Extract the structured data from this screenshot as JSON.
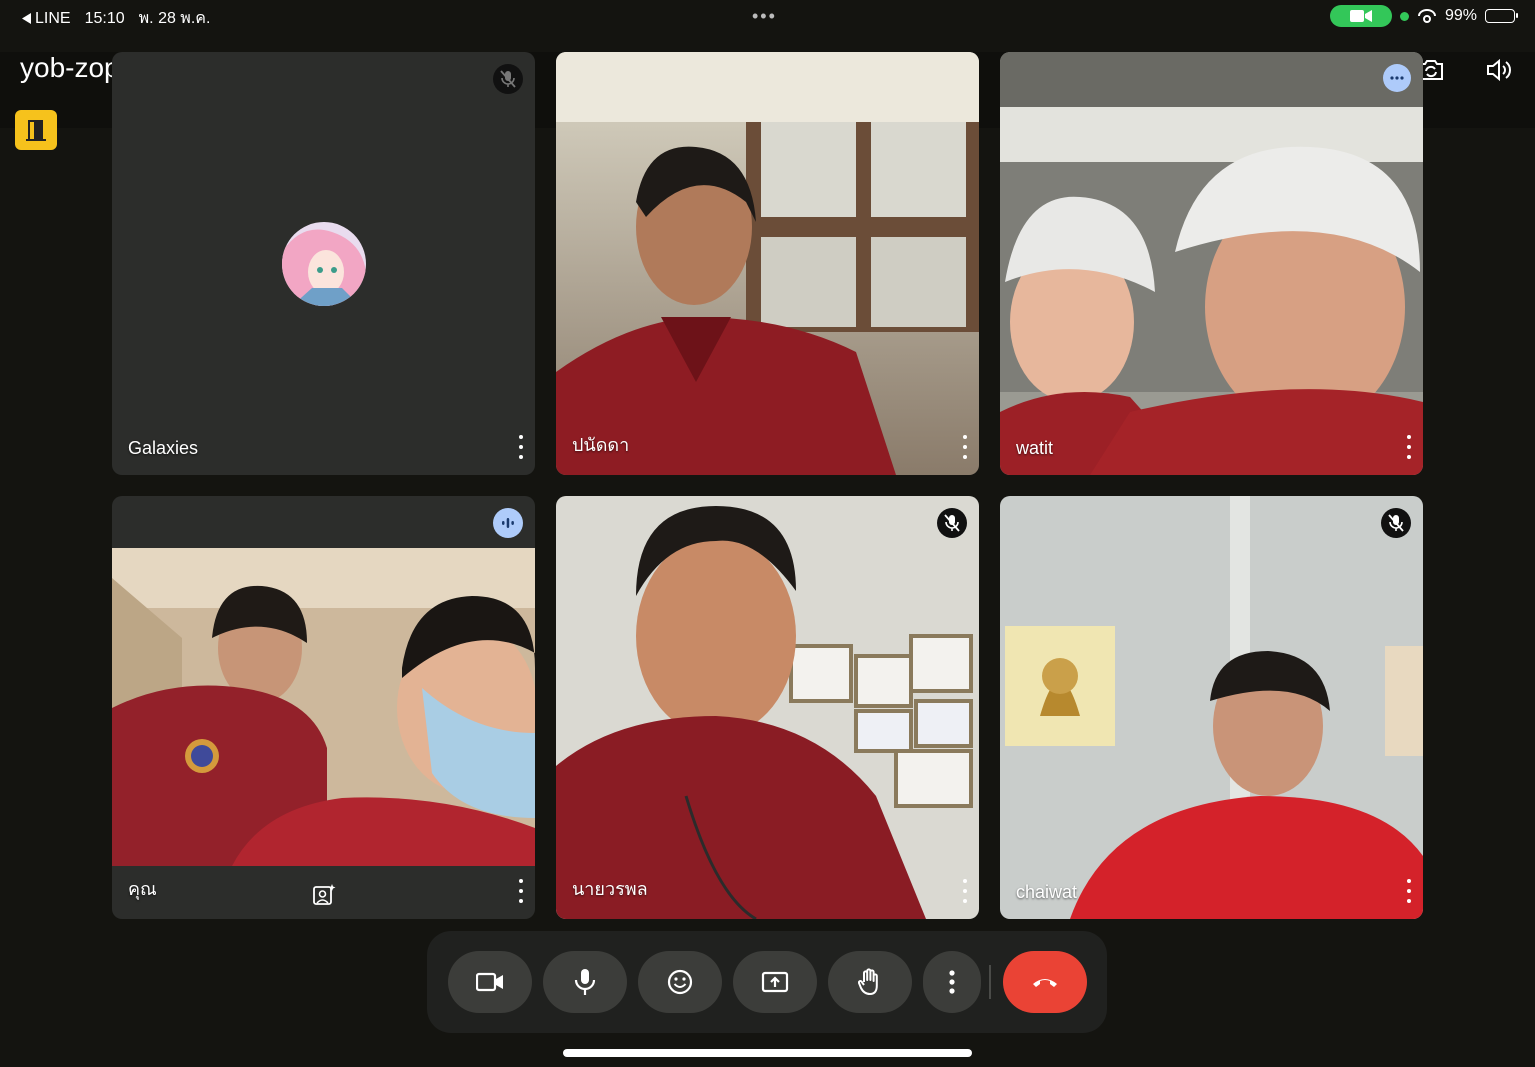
{
  "status_bar": {
    "back_app": "LINE",
    "time": "15:10",
    "date": "พ. 28 พ.ค.",
    "battery": "99%",
    "camera_active_color": "#33c759"
  },
  "meeting": {
    "code": "yob-zopp-gna"
  },
  "participants": [
    {
      "name": "Galaxies",
      "mic": "muted",
      "video": "off"
    },
    {
      "name": "ปนัดดา",
      "mic": "on",
      "video": "on"
    },
    {
      "name": "watit",
      "mic": "on",
      "video": "on",
      "indicator": "more-options"
    },
    {
      "name": "คุณ",
      "mic": "speaking",
      "video": "on",
      "is_self": true
    },
    {
      "name": "นายวรพล",
      "mic": "muted",
      "video": "on"
    },
    {
      "name": "chaiwat",
      "mic": "muted",
      "video": "on"
    }
  ],
  "controls": {
    "buttons": [
      "camera-icon",
      "microphone-icon",
      "emoji-icon",
      "present-screen-icon",
      "raise-hand-icon",
      "more-options-icon",
      "end-call-icon"
    ],
    "end_call_color": "#ea4335"
  },
  "icons": {
    "header_right": [
      "switch-camera-icon",
      "speaker-icon"
    ],
    "side_button": "door-icon"
  },
  "accent": {
    "side_button": "#f6c21c",
    "speaking_badge": "#aecbfa"
  }
}
